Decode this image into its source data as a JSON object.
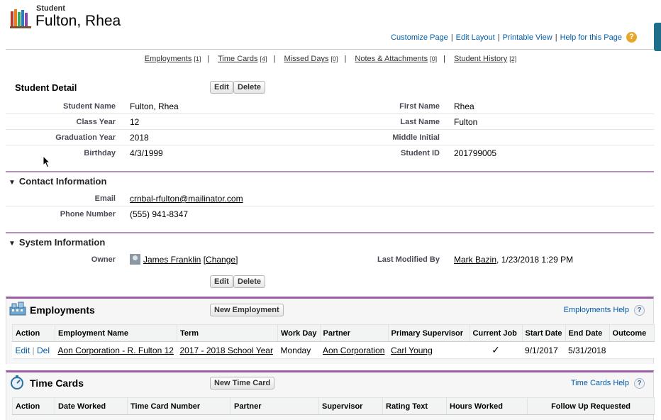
{
  "header": {
    "object_type": "Student",
    "record_name": "Fulton, Rhea",
    "links": [
      "Customize Page",
      "Edit Layout",
      "Printable View",
      "Help for this Page"
    ],
    "help_badge": "?"
  },
  "related_links": [
    {
      "label": "Employments",
      "count": "[1]"
    },
    {
      "label": "Time Cards",
      "count": "[4]"
    },
    {
      "label": "Missed Days",
      "count": "[0]"
    },
    {
      "label": "Notes & Attachments",
      "count": "[0]"
    },
    {
      "label": "Student History",
      "count": "[2]"
    }
  ],
  "detail": {
    "title": "Student Detail",
    "edit": "Edit",
    "delete": "Delete",
    "rows": [
      {
        "l1": "Student Name",
        "v1": "Fulton, Rhea",
        "l2": "First Name",
        "v2": "Rhea"
      },
      {
        "l1": "Class Year",
        "v1": "12",
        "l2": "Last Name",
        "v2": "Fulton"
      },
      {
        "l1": "Graduation Year",
        "v1": "2018",
        "l2": "Middle Initial",
        "v2": ""
      },
      {
        "l1": "Birthday",
        "v1": "4/3/1999",
        "l2": "Student ID",
        "v2": "201799005"
      }
    ]
  },
  "contact": {
    "title": "Contact Information",
    "email_label": "Email",
    "email": "crnbal-rfulton@mailinator.com",
    "phone_label": "Phone Number",
    "phone": "(555) 941-8347"
  },
  "system": {
    "title": "System Information",
    "owner_label": "Owner",
    "owner": "James Franklin",
    "change": "[Change]",
    "modified_label": "Last Modified By",
    "modified_by": "Mark Bazin",
    "modified_at": ", 1/23/2018 1:29 PM"
  },
  "bottom_buttons": {
    "edit": "Edit",
    "delete": "Delete"
  },
  "employments": {
    "title": "Employments",
    "new_button": "New Employment",
    "help": "Employments Help",
    "columns": [
      "Action",
      "Employment Name",
      "Term",
      "Work Day",
      "Partner",
      "Primary Supervisor",
      "Current Job",
      "Start Date",
      "End Date",
      "Outcome"
    ],
    "row": {
      "edit": "Edit",
      "sep": "|",
      "del": "Del",
      "name": "Aon Corporation - R. Fulton 12",
      "term": "2017 - 2018 School Year",
      "work_day": "Monday",
      "partner": "Aon Corporation",
      "supervisor": "Carl Young",
      "current_job": "✓",
      "start": "9/1/2017",
      "end": "5/31/2018",
      "outcome": ""
    }
  },
  "time_cards": {
    "title": "Time Cards",
    "new_button": "New Time Card",
    "help": "Time Cards Help",
    "columns": [
      "Action",
      "Date Worked",
      "Time Card Number",
      "Partner",
      "Supervisor",
      "Rating Text",
      "Hours Worked",
      "Follow Up Requested"
    ]
  }
}
